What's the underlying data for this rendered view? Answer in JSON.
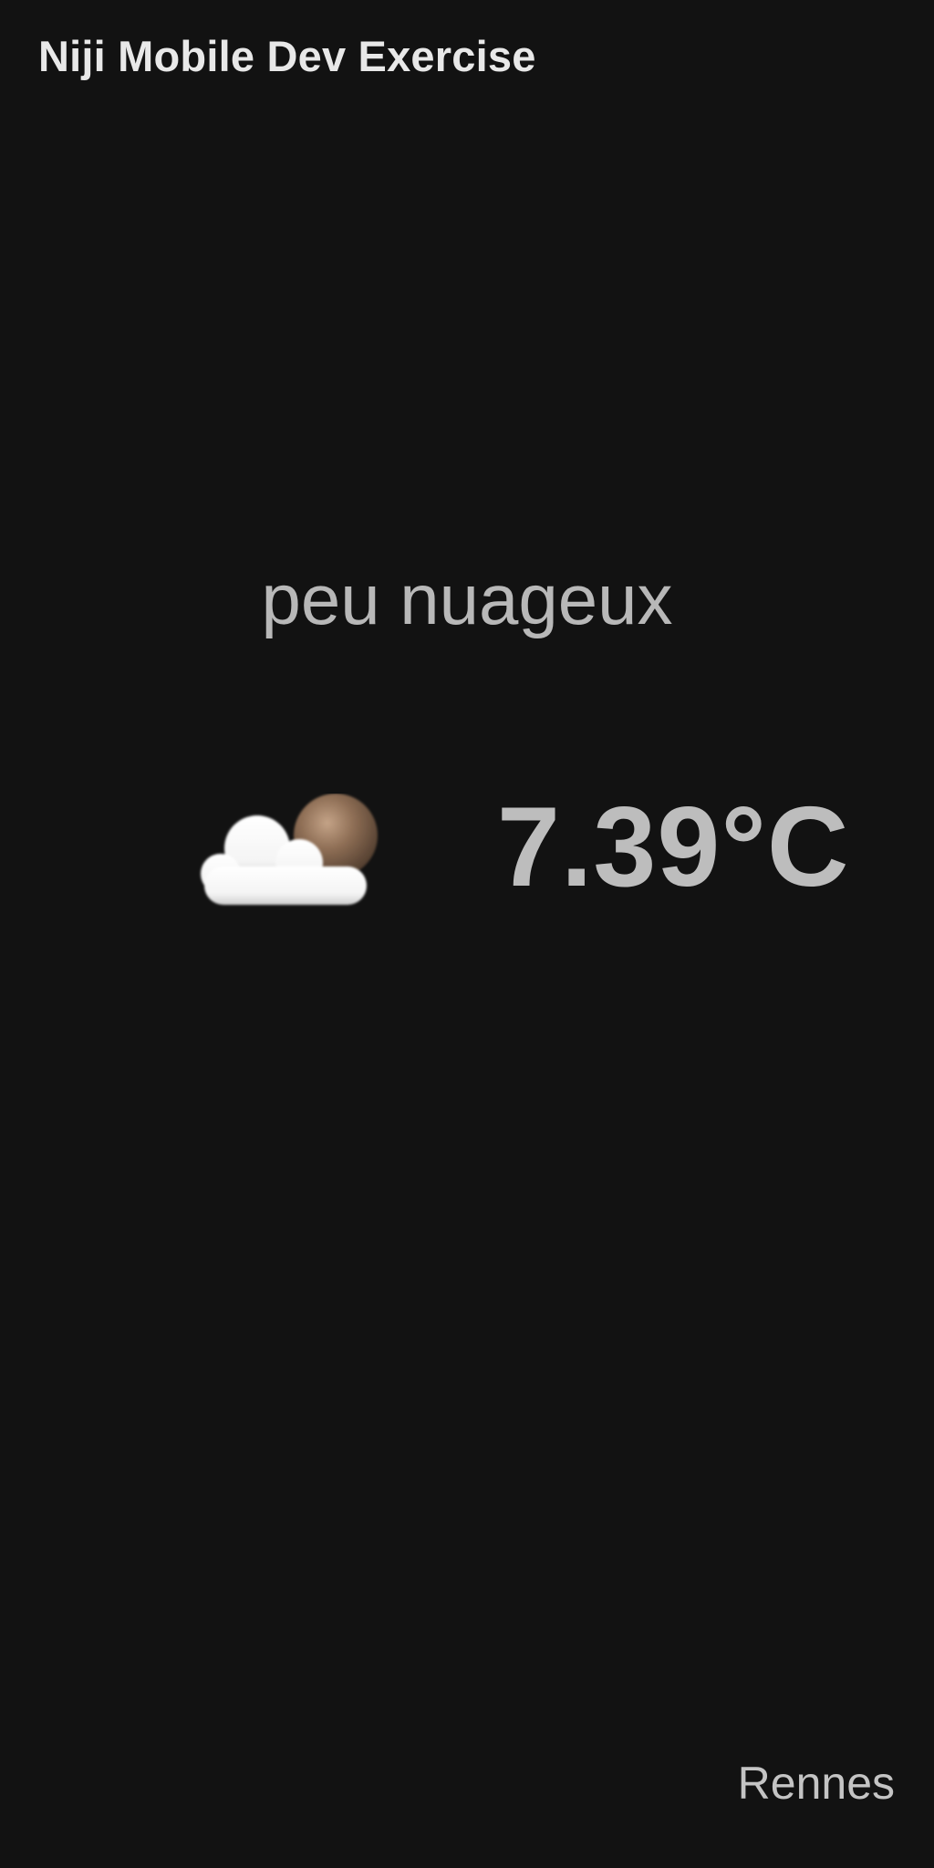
{
  "app_bar": {
    "title": "Niji Mobile Dev Exercise"
  },
  "weather": {
    "description": "peu nuageux",
    "temperature": "7.39°C",
    "icon": "few-clouds-icon"
  },
  "location": {
    "city": "Rennes"
  },
  "colors": {
    "background": "#121212",
    "title_text": "#e8e8e8",
    "body_text": "#bdbdbd",
    "cloud": "#ffffff",
    "sun": "#8b6a52"
  }
}
